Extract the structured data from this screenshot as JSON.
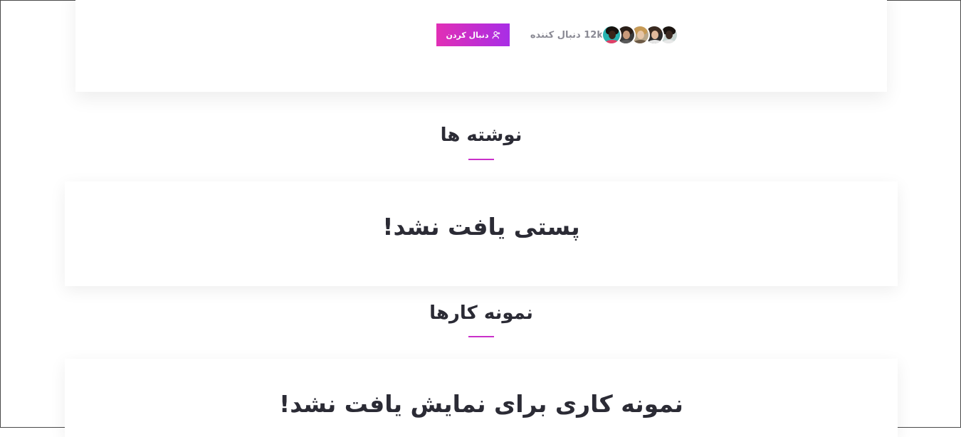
{
  "profile": {
    "avatars": [
      {
        "name": "follower-avatar-1",
        "bg": "#c9d6d3",
        "skin": "#3b2a22",
        "hair": "#1b1410",
        "shirt": "#e8e8e8"
      },
      {
        "name": "follower-avatar-2",
        "bg": "#2c2c2c",
        "skin": "#e1b99b",
        "hair": "#3a2a20",
        "shirt": "#e6e6e6"
      },
      {
        "name": "follower-avatar-3",
        "bg": "#b8a78a",
        "skin": "#e7c6a7",
        "hair": "#c79a55",
        "shirt": "#6d5a46"
      },
      {
        "name": "follower-avatar-4",
        "bg": "#3a3a3a",
        "skin": "#c99a7a",
        "hair": "#2a1e18",
        "shirt": "#5a5a5a"
      },
      {
        "name": "follower-avatar-5",
        "bg": "#27b3b0",
        "skin": "#3b2418",
        "hair": "#17110d",
        "shirt": "#e23f67"
      }
    ],
    "follower_count": "12k دنبال کننده",
    "follow_button_label": "دنبال کردن",
    "follow_icon": "user-plus-icon"
  },
  "posts": {
    "heading": "نوشته ها",
    "empty_message": "پستی یافت نشد!"
  },
  "portfolio": {
    "heading": "نمونه کارها",
    "empty_message": "نمونه کاری برای نمایش یافت نشد!"
  },
  "colors": {
    "accent": "#c930c9",
    "button_gradient_start": "#e12fb5",
    "button_gradient_end": "#a82ee6",
    "text_dark": "#2b2b35",
    "text_muted": "#8a8a94"
  }
}
